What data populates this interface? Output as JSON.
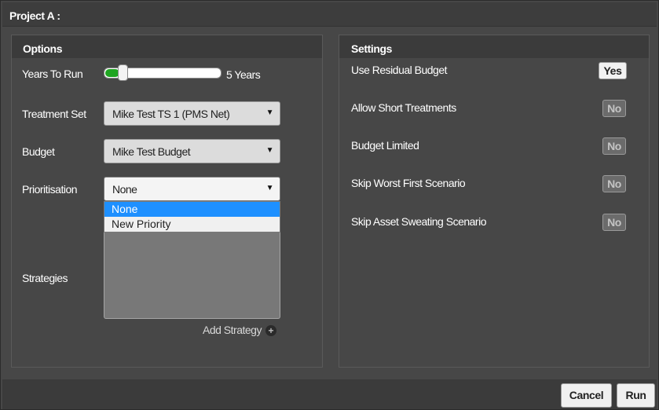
{
  "dialog": {
    "title": "Project A :"
  },
  "options": {
    "header": "Options",
    "years_to_run": {
      "label": "Years To Run",
      "value_text": "5 Years",
      "slider_fraction": 0.12
    },
    "treatment_set": {
      "label": "Treatment Set",
      "selected": "Mike Test TS 1 (PMS Net)"
    },
    "budget": {
      "label": "Budget",
      "selected": "Mike Test Budget"
    },
    "prioritisation": {
      "label": "Prioritisation",
      "selected": "None",
      "options": [
        "None",
        "New Priority"
      ],
      "highlighted_index": 0
    },
    "strategies": {
      "label": "Strategies"
    },
    "add_strategy": {
      "label": "Add Strategy",
      "icon": "plus-circle-icon"
    }
  },
  "settings": {
    "header": "Settings",
    "items": [
      {
        "label": "Use Residual Budget",
        "value": "Yes",
        "on": true
      },
      {
        "label": "Allow Short Treatments",
        "value": "No",
        "on": false
      },
      {
        "label": "Budget Limited",
        "value": "No",
        "on": false
      },
      {
        "label": "Skip Worst First Scenario",
        "value": "No",
        "on": false
      },
      {
        "label": "Skip Asset Sweating Scenario",
        "value": "No",
        "on": false
      }
    ]
  },
  "footer": {
    "cancel_label": "Cancel",
    "run_label": "Run"
  },
  "colors": {
    "slider_fill": "#1fa521",
    "highlight": "#1e90ff",
    "background": "#474747"
  }
}
